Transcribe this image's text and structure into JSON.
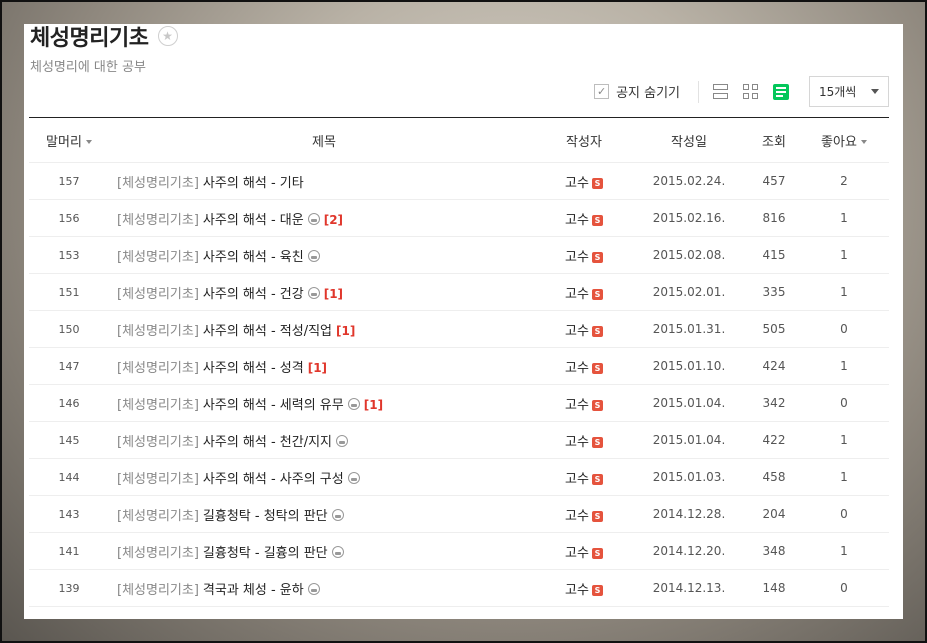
{
  "header": {
    "title": "체성명리기초",
    "description": "체성명리에 대한 공부"
  },
  "toolbar": {
    "notice_toggle_label": "공지 숨기기",
    "per_page": "15개씩"
  },
  "columns": {
    "no": "말머리",
    "title": "제목",
    "author": "작성자",
    "date": "작성일",
    "views": "조회",
    "likes": "좋아요"
  },
  "rows": [
    {
      "no": "157",
      "tag": "[체성명리기초]",
      "subject": "사주의 해석 - 기타",
      "image": false,
      "comments": "",
      "author": "고수",
      "date": "2015.02.24.",
      "views": "457",
      "likes": "2"
    },
    {
      "no": "156",
      "tag": "[체성명리기초]",
      "subject": "사주의 해석 - 대운",
      "image": true,
      "comments": "[2]",
      "author": "고수",
      "date": "2015.02.16.",
      "views": "816",
      "likes": "1"
    },
    {
      "no": "153",
      "tag": "[체성명리기초]",
      "subject": "사주의 해석 - 육친",
      "image": true,
      "comments": "",
      "author": "고수",
      "date": "2015.02.08.",
      "views": "415",
      "likes": "1"
    },
    {
      "no": "151",
      "tag": "[체성명리기초]",
      "subject": "사주의 해석 - 건강",
      "image": true,
      "comments": "[1]",
      "author": "고수",
      "date": "2015.02.01.",
      "views": "335",
      "likes": "1"
    },
    {
      "no": "150",
      "tag": "[체성명리기초]",
      "subject": "사주의 해석 - 적성/직업",
      "image": false,
      "comments": "[1]",
      "author": "고수",
      "date": "2015.01.31.",
      "views": "505",
      "likes": "0"
    },
    {
      "no": "147",
      "tag": "[체성명리기초]",
      "subject": "사주의 해석 - 성격",
      "image": false,
      "comments": "[1]",
      "author": "고수",
      "date": "2015.01.10.",
      "views": "424",
      "likes": "1"
    },
    {
      "no": "146",
      "tag": "[체성명리기초]",
      "subject": "사주의 해석 - 세력의 유무",
      "image": true,
      "comments": "[1]",
      "author": "고수",
      "date": "2015.01.04.",
      "views": "342",
      "likes": "0"
    },
    {
      "no": "145",
      "tag": "[체성명리기초]",
      "subject": "사주의 해석 - 천간/지지",
      "image": true,
      "comments": "",
      "author": "고수",
      "date": "2015.01.04.",
      "views": "422",
      "likes": "1"
    },
    {
      "no": "144",
      "tag": "[체성명리기초]",
      "subject": "사주의 해석 - 사주의 구성",
      "image": true,
      "comments": "",
      "author": "고수",
      "date": "2015.01.03.",
      "views": "458",
      "likes": "1"
    },
    {
      "no": "143",
      "tag": "[체성명리기초]",
      "subject": "길흉청탁 - 청탁의 판단",
      "image": true,
      "comments": "",
      "author": "고수",
      "date": "2014.12.28.",
      "views": "204",
      "likes": "0"
    },
    {
      "no": "141",
      "tag": "[체성명리기초]",
      "subject": "길흉청탁 - 길흉의 판단",
      "image": true,
      "comments": "",
      "author": "고수",
      "date": "2014.12.20.",
      "views": "348",
      "likes": "1"
    },
    {
      "no": "139",
      "tag": "[체성명리기초]",
      "subject": "격국과 체성 - 윤하",
      "image": true,
      "comments": "",
      "author": "고수",
      "date": "2014.12.13.",
      "views": "148",
      "likes": "0"
    }
  ]
}
